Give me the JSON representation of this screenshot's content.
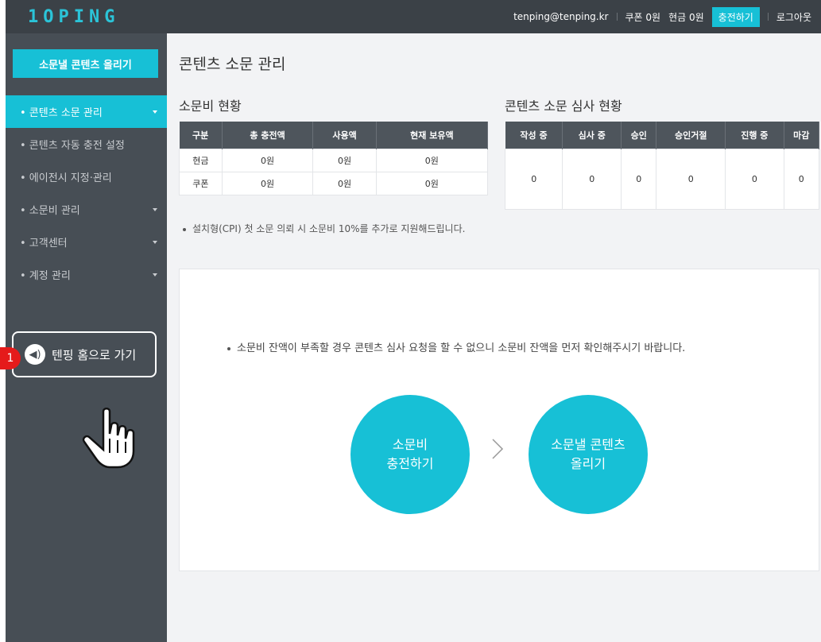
{
  "header": {
    "logo_text": "1OPING",
    "email": "tenping@tenping.kr",
    "coupon": "쿠폰 0원",
    "cash": "현금 0원",
    "charge_label": "충전하기",
    "logout_label": "로그아웃"
  },
  "sidebar": {
    "upload_label": "소문낼 콘텐츠 올리기",
    "items": [
      {
        "label": "• 콘텐츠 소문 관리",
        "active": true
      },
      {
        "label": "• 콘텐츠 자동 충전 설정"
      },
      {
        "label": "• 에이전시 지정·관리"
      },
      {
        "label": "• 소문비 관리"
      },
      {
        "label": "• 고객센터"
      },
      {
        "label": "• 계정 관리"
      }
    ],
    "home_label": "텐핑 홈으로 가기",
    "badge": "1"
  },
  "main": {
    "page_title": "콘텐츠 소문 관리",
    "fee_title": "소문비 현황",
    "fee_table": {
      "headers": [
        "구분",
        "총 충전액",
        "사용액",
        "현재 보유액"
      ],
      "rows": [
        [
          "현금",
          "0원",
          "0원",
          "0원"
        ],
        [
          "쿠폰",
          "0원",
          "0원",
          "0원"
        ]
      ]
    },
    "review_title": "콘텐츠 소문 심사 현황",
    "review_table": {
      "headers": [
        "작성 중",
        "심사 중",
        "승인",
        "승인거절",
        "진행 중",
        "마감"
      ],
      "values": [
        "0",
        "0",
        "0",
        "0",
        "0",
        "0"
      ]
    },
    "note": "설치형(CPI) 첫 소문 의뢰 시 소문비 10%를 추가로 지원해드립니다.",
    "notice": "소문비 잔액이 부족할 경우 콘텐츠 심사 요청을 할 수 없으니 소문비 잔액을 먼저 확인해주시기 바랍니다.",
    "step1_line1": "소문비",
    "step1_line2": "충전하기",
    "step2_line1": "소문낼 콘텐츠",
    "step2_line2": "올리기"
  }
}
